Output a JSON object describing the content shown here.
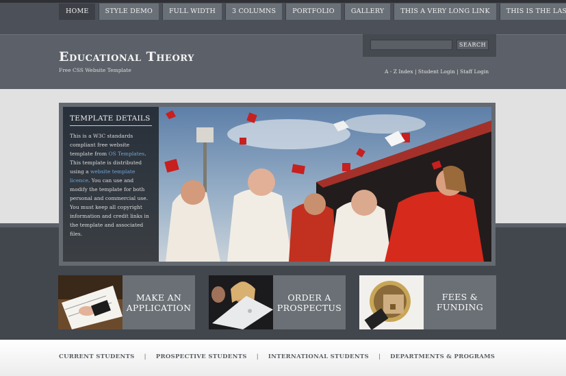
{
  "nav": {
    "items": [
      {
        "label": "HOME"
      },
      {
        "label": "STYLE DEMO"
      },
      {
        "label": "FULL WIDTH"
      },
      {
        "label": "3 COLUMNS"
      },
      {
        "label": "PORTFOLIO"
      },
      {
        "label": "GALLERY"
      },
      {
        "label": "THIS A VERY LONG LINK"
      },
      {
        "label": "THIS IS THE LAST"
      }
    ]
  },
  "header": {
    "title": "Educational Theory",
    "subtitle": "Free CSS Website Template"
  },
  "search": {
    "button_label": "SEARCH",
    "value": ""
  },
  "toplinks": {
    "az": "A - Z Index",
    "sep": " | ",
    "student": "Student Login",
    "staff": "Staff Login"
  },
  "featured": {
    "title": "TEMPLATE DETAILS",
    "text_1": "This is a W3C standards compliant free website template from ",
    "link_1": "OS Templates",
    "text_2": ". This template is distributed using a ",
    "link_2": "website template licence",
    "text_3": ". You can use and modify the template for both personal and commercial use. You must keep all copyright information and credit links in the template and associated files."
  },
  "promos": [
    {
      "label_line1": "MAKE AN",
      "label_line2": "APPLICATION"
    },
    {
      "label_line1": "ORDER A",
      "label_line2": "PROSPECTUS"
    },
    {
      "label_line1": "FEES & FUNDING",
      "label_line2": ""
    }
  ],
  "footer_nav": {
    "items": [
      {
        "label": "CURRENT STUDENTS"
      },
      {
        "label": "PROSPECTIVE STUDENTS"
      },
      {
        "label": "INTERNATIONAL STUDENTS"
      },
      {
        "label": "DEPARTMENTS & PROGRAMS"
      }
    ],
    "separator": "|"
  },
  "colors": {
    "topbar": "#4c5058",
    "header": "#5c6169",
    "link": "#6fa6d8",
    "promo_box": "#6a7076",
    "gown_red": "#d62a1c"
  }
}
